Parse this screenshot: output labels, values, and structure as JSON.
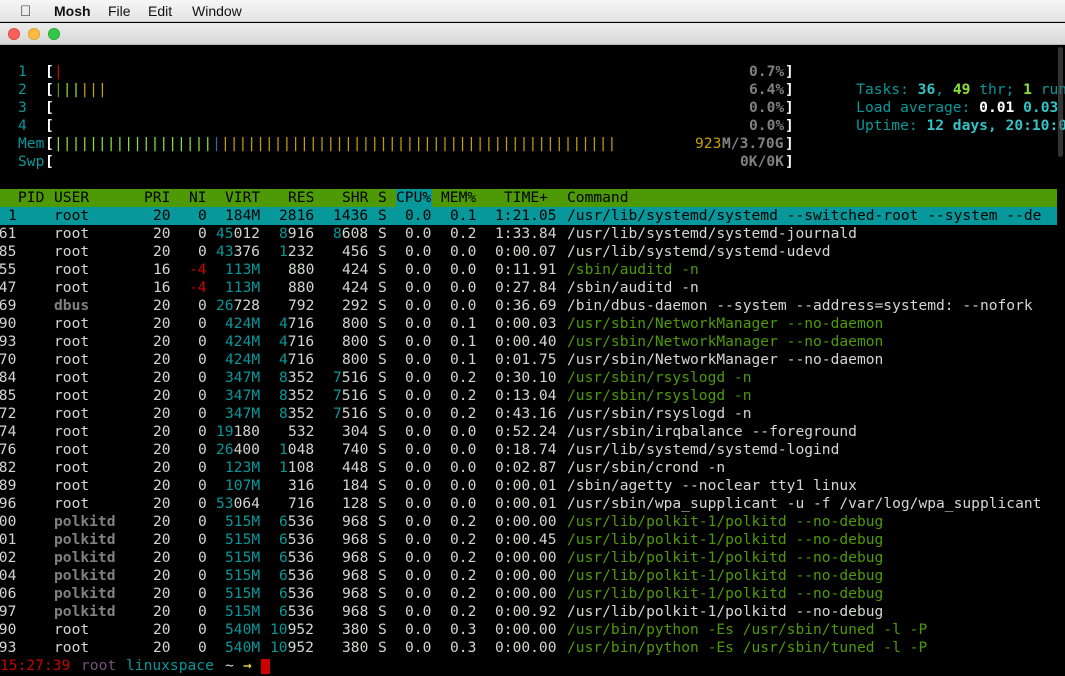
{
  "menubar": {
    "app": "Mosh",
    "items": [
      "File",
      "Edit",
      "Window"
    ]
  },
  "meters": {
    "cpus": [
      {
        "label": "1",
        "bar": "|",
        "pct": "0.7%"
      },
      {
        "label": "2",
        "bar": "||||||",
        "pct": "6.4%"
      },
      {
        "label": "3",
        "bar": "",
        "pct": "0.0%"
      },
      {
        "label": "4",
        "bar": "",
        "pct": "0.0%"
      }
    ],
    "mem": {
      "label": "Mem",
      "bar_green": "||||||||||||||||||",
      "bar_blue": "|",
      "bar_yellow": "|||||||||||||||||||||||||||||||||||||||||||||",
      "used": "923",
      "total": "M/3.70G"
    },
    "swp": {
      "label": "Swp",
      "value": "0K/0K"
    }
  },
  "summary": {
    "tasks_label": "Tasks: ",
    "tasks": "36",
    "comma": ", ",
    "threads": "49",
    "thr_label": " thr; ",
    "running": "1",
    "running_label": " runni",
    "load_label": "Load average: ",
    "load1": "0.01",
    "load5": "0.03",
    "load15": "0.",
    "uptime_label": "Uptime: ",
    "uptime": "12 days, 20:10:04"
  },
  "columns": [
    "PID",
    "USER",
    "PRI",
    "NI",
    "VIRT",
    "RES",
    "SHR",
    "S",
    "CPU%",
    "MEM%",
    "TIME+",
    "Command"
  ],
  "processes": [
    {
      "pid": "1",
      "user": "root",
      "pri": "20",
      "ni": "0",
      "virt": "184M",
      "res": "2816",
      "shr": "1436",
      "s": "S",
      "cpu": "0.0",
      "mem": "0.1",
      "time": "1:21.05",
      "cmd": "/usr/lib/systemd/systemd --switched-root --system --de",
      "selected": true,
      "thread": false,
      "virt_hl": 0,
      "res_hl": 0,
      "shr_hl": 0
    },
    {
      "pid": "361",
      "user": "root",
      "pri": "20",
      "ni": "0",
      "virt": "45012",
      "res": "8916",
      "shr": "8608",
      "s": "S",
      "cpu": "0.0",
      "mem": "0.2",
      "time": "1:33.84",
      "cmd": "/usr/lib/systemd/systemd-journald",
      "selected": false,
      "thread": false,
      "virt_hl": 2,
      "res_hl": 1,
      "shr_hl": 1
    },
    {
      "pid": "385",
      "user": "root",
      "pri": "20",
      "ni": "0",
      "virt": "43376",
      "res": "1232",
      "shr": "456",
      "s": "S",
      "cpu": "0.0",
      "mem": "0.0",
      "time": "0:00.07",
      "cmd": "/usr/lib/systemd/systemd-udevd",
      "selected": false,
      "thread": false,
      "virt_hl": 2,
      "res_hl": 1,
      "shr_hl": 0
    },
    {
      "pid": "455",
      "user": "root",
      "pri": "16",
      "ni": "-4",
      "virt": "113M",
      "res": "880",
      "shr": "424",
      "s": "S",
      "cpu": "0.0",
      "mem": "0.0",
      "time": "0:11.91",
      "cmd": "/sbin/auditd -n",
      "selected": false,
      "thread": true,
      "virt_hl": 0,
      "res_hl": 0,
      "shr_hl": 0
    },
    {
      "pid": "447",
      "user": "root",
      "pri": "16",
      "ni": "-4",
      "virt": "113M",
      "res": "880",
      "shr": "424",
      "s": "S",
      "cpu": "0.0",
      "mem": "0.0",
      "time": "0:27.84",
      "cmd": "/sbin/auditd -n",
      "selected": false,
      "thread": false,
      "virt_hl": 0,
      "res_hl": 0,
      "shr_hl": 0
    },
    {
      "pid": "469",
      "user": "dbus",
      "pri": "20",
      "ni": "0",
      "virt": "26728",
      "res": "792",
      "shr": "292",
      "s": "S",
      "cpu": "0.0",
      "mem": "0.0",
      "time": "0:36.69",
      "cmd": "/bin/dbus-daemon --system --address=systemd: --nofork",
      "selected": false,
      "thread": false,
      "virt_hl": 2,
      "res_hl": 0,
      "shr_hl": 0
    },
    {
      "pid": "490",
      "user": "root",
      "pri": "20",
      "ni": "0",
      "virt": "424M",
      "res": "4716",
      "shr": "800",
      "s": "S",
      "cpu": "0.0",
      "mem": "0.1",
      "time": "0:00.03",
      "cmd": "/usr/sbin/NetworkManager --no-daemon",
      "selected": false,
      "thread": true,
      "virt_hl": 0,
      "res_hl": 1,
      "shr_hl": 0
    },
    {
      "pid": "493",
      "user": "root",
      "pri": "20",
      "ni": "0",
      "virt": "424M",
      "res": "4716",
      "shr": "800",
      "s": "S",
      "cpu": "0.0",
      "mem": "0.1",
      "time": "0:00.40",
      "cmd": "/usr/sbin/NetworkManager --no-daemon",
      "selected": false,
      "thread": true,
      "virt_hl": 0,
      "res_hl": 1,
      "shr_hl": 0
    },
    {
      "pid": "470",
      "user": "root",
      "pri": "20",
      "ni": "0",
      "virt": "424M",
      "res": "4716",
      "shr": "800",
      "s": "S",
      "cpu": "0.0",
      "mem": "0.1",
      "time": "0:01.75",
      "cmd": "/usr/sbin/NetworkManager --no-daemon",
      "selected": false,
      "thread": false,
      "virt_hl": 0,
      "res_hl": 1,
      "shr_hl": 0
    },
    {
      "pid": "484",
      "user": "root",
      "pri": "20",
      "ni": "0",
      "virt": "347M",
      "res": "8352",
      "shr": "7516",
      "s": "S",
      "cpu": "0.0",
      "mem": "0.2",
      "time": "0:30.10",
      "cmd": "/usr/sbin/rsyslogd -n",
      "selected": false,
      "thread": true,
      "virt_hl": 0,
      "res_hl": 1,
      "shr_hl": 1
    },
    {
      "pid": "485",
      "user": "root",
      "pri": "20",
      "ni": "0",
      "virt": "347M",
      "res": "8352",
      "shr": "7516",
      "s": "S",
      "cpu": "0.0",
      "mem": "0.2",
      "time": "0:13.04",
      "cmd": "/usr/sbin/rsyslogd -n",
      "selected": false,
      "thread": true,
      "virt_hl": 0,
      "res_hl": 1,
      "shr_hl": 1
    },
    {
      "pid": "472",
      "user": "root",
      "pri": "20",
      "ni": "0",
      "virt": "347M",
      "res": "8352",
      "shr": "7516",
      "s": "S",
      "cpu": "0.0",
      "mem": "0.2",
      "time": "0:43.16",
      "cmd": "/usr/sbin/rsyslogd -n",
      "selected": false,
      "thread": false,
      "virt_hl": 0,
      "res_hl": 1,
      "shr_hl": 1
    },
    {
      "pid": "474",
      "user": "root",
      "pri": "20",
      "ni": "0",
      "virt": "19180",
      "res": "532",
      "shr": "304",
      "s": "S",
      "cpu": "0.0",
      "mem": "0.0",
      "time": "0:52.24",
      "cmd": "/usr/sbin/irqbalance --foreground",
      "selected": false,
      "thread": false,
      "virt_hl": 2,
      "res_hl": 0,
      "shr_hl": 0
    },
    {
      "pid": "476",
      "user": "root",
      "pri": "20",
      "ni": "0",
      "virt": "26400",
      "res": "1048",
      "shr": "740",
      "s": "S",
      "cpu": "0.0",
      "mem": "0.0",
      "time": "0:18.74",
      "cmd": "/usr/lib/systemd/systemd-logind",
      "selected": false,
      "thread": false,
      "virt_hl": 2,
      "res_hl": 1,
      "shr_hl": 0
    },
    {
      "pid": "482",
      "user": "root",
      "pri": "20",
      "ni": "0",
      "virt": "123M",
      "res": "1108",
      "shr": "448",
      "s": "S",
      "cpu": "0.0",
      "mem": "0.0",
      "time": "0:02.87",
      "cmd": "/usr/sbin/crond -n",
      "selected": false,
      "thread": false,
      "virt_hl": 0,
      "res_hl": 1,
      "shr_hl": 0
    },
    {
      "pid": "489",
      "user": "root",
      "pri": "20",
      "ni": "0",
      "virt": "107M",
      "res": "316",
      "shr": "184",
      "s": "S",
      "cpu": "0.0",
      "mem": "0.0",
      "time": "0:00.01",
      "cmd": "/sbin/agetty --noclear tty1 linux",
      "selected": false,
      "thread": false,
      "virt_hl": 0,
      "res_hl": 0,
      "shr_hl": 0
    },
    {
      "pid": "496",
      "user": "root",
      "pri": "20",
      "ni": "0",
      "virt": "53064",
      "res": "716",
      "shr": "128",
      "s": "S",
      "cpu": "0.0",
      "mem": "0.0",
      "time": "0:00.01",
      "cmd": "/usr/sbin/wpa_supplicant -u -f /var/log/wpa_supplicant",
      "selected": false,
      "thread": false,
      "virt_hl": 2,
      "res_hl": 0,
      "shr_hl": 0
    },
    {
      "pid": "500",
      "user": "polkitd",
      "pri": "20",
      "ni": "0",
      "virt": "515M",
      "res": "6536",
      "shr": "968",
      "s": "S",
      "cpu": "0.0",
      "mem": "0.2",
      "time": "0:00.00",
      "cmd": "/usr/lib/polkit-1/polkitd --no-debug",
      "selected": false,
      "thread": true,
      "virt_hl": 0,
      "res_hl": 1,
      "shr_hl": 0
    },
    {
      "pid": "501",
      "user": "polkitd",
      "pri": "20",
      "ni": "0",
      "virt": "515M",
      "res": "6536",
      "shr": "968",
      "s": "S",
      "cpu": "0.0",
      "mem": "0.2",
      "time": "0:00.45",
      "cmd": "/usr/lib/polkit-1/polkitd --no-debug",
      "selected": false,
      "thread": true,
      "virt_hl": 0,
      "res_hl": 1,
      "shr_hl": 0
    },
    {
      "pid": "502",
      "user": "polkitd",
      "pri": "20",
      "ni": "0",
      "virt": "515M",
      "res": "6536",
      "shr": "968",
      "s": "S",
      "cpu": "0.0",
      "mem": "0.2",
      "time": "0:00.00",
      "cmd": "/usr/lib/polkit-1/polkitd --no-debug",
      "selected": false,
      "thread": true,
      "virt_hl": 0,
      "res_hl": 1,
      "shr_hl": 0
    },
    {
      "pid": "504",
      "user": "polkitd",
      "pri": "20",
      "ni": "0",
      "virt": "515M",
      "res": "6536",
      "shr": "968",
      "s": "S",
      "cpu": "0.0",
      "mem": "0.2",
      "time": "0:00.00",
      "cmd": "/usr/lib/polkit-1/polkitd --no-debug",
      "selected": false,
      "thread": true,
      "virt_hl": 0,
      "res_hl": 1,
      "shr_hl": 0
    },
    {
      "pid": "506",
      "user": "polkitd",
      "pri": "20",
      "ni": "0",
      "virt": "515M",
      "res": "6536",
      "shr": "968",
      "s": "S",
      "cpu": "0.0",
      "mem": "0.2",
      "time": "0:00.00",
      "cmd": "/usr/lib/polkit-1/polkitd --no-debug",
      "selected": false,
      "thread": true,
      "virt_hl": 0,
      "res_hl": 1,
      "shr_hl": 0
    },
    {
      "pid": "497",
      "user": "polkitd",
      "pri": "20",
      "ni": "0",
      "virt": "515M",
      "res": "6536",
      "shr": "968",
      "s": "S",
      "cpu": "0.0",
      "mem": "0.2",
      "time": "0:00.92",
      "cmd": "/usr/lib/polkit-1/polkitd --no-debug",
      "selected": false,
      "thread": false,
      "virt_hl": 0,
      "res_hl": 1,
      "shr_hl": 0
    },
    {
      "pid": "890",
      "user": "root",
      "pri": "20",
      "ni": "0",
      "virt": "540M",
      "res": "10952",
      "shr": "380",
      "s": "S",
      "cpu": "0.0",
      "mem": "0.3",
      "time": "0:00.00",
      "cmd": "/usr/bin/python -Es /usr/sbin/tuned -l -P",
      "selected": false,
      "thread": true,
      "virt_hl": 0,
      "res_hl": 2,
      "shr_hl": 0
    },
    {
      "pid": "893",
      "user": "root",
      "pri": "20",
      "ni": "0",
      "virt": "540M",
      "res": "10952",
      "shr": "380",
      "s": "S",
      "cpu": "0.0",
      "mem": "0.3",
      "time": "0:00.00",
      "cmd": "/usr/bin/python -Es /usr/sbin/tuned -l -P",
      "selected": false,
      "thread": true,
      "virt_hl": 0,
      "res_hl": 2,
      "shr_hl": 0
    }
  ],
  "prompt": {
    "time": "15:27:39",
    "user": "root",
    "host": "linuxspace",
    "dir": "~",
    "arrow": "→"
  }
}
